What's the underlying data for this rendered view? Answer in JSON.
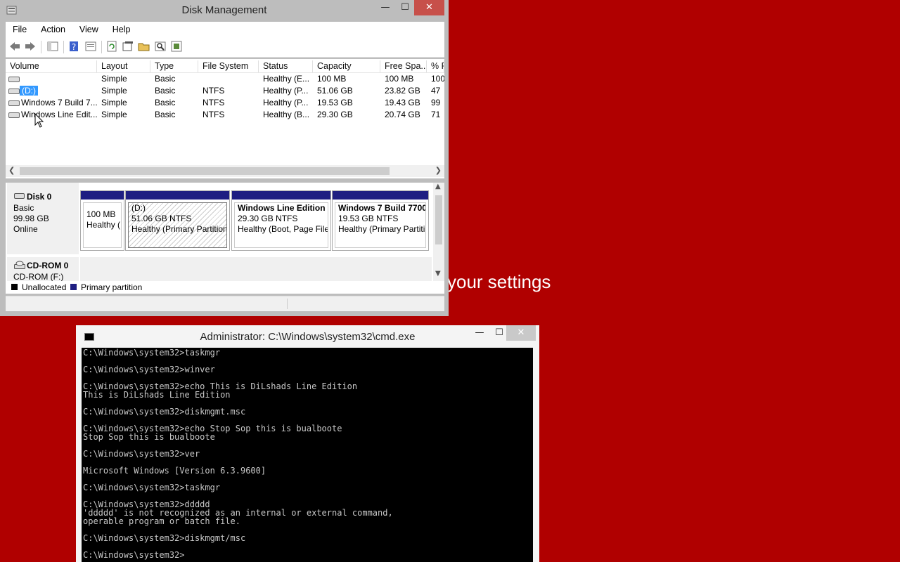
{
  "background": {
    "color": "#b00000",
    "text": "your settings"
  },
  "disk_management": {
    "title": "Disk Management",
    "window_buttons": {
      "minimize": "—",
      "maximize": "☐",
      "close": "✕"
    },
    "menu": [
      "File",
      "Action",
      "View",
      "Help"
    ],
    "toolbar_icons": [
      "back-icon",
      "forward-icon",
      "console-tree-icon",
      "help-icon",
      "properties-icon",
      "refresh-icon",
      "rescan-icon",
      "open-icon",
      "explore-icon",
      "settings-icon"
    ],
    "columns": [
      "Volume",
      "Layout",
      "Type",
      "File System",
      "Status",
      "Capacity",
      "Free Spa...",
      "% F"
    ],
    "rows": [
      {
        "volume": "",
        "layout": "Simple",
        "type": "Basic",
        "fs": "",
        "status": "Healthy (E...",
        "capacity": "100 MB",
        "free": "100 MB",
        "pct": "100"
      },
      {
        "volume": "(D:)",
        "layout": "Simple",
        "type": "Basic",
        "fs": "NTFS",
        "status": "Healthy (P...",
        "capacity": "51.06 GB",
        "free": "23.82 GB",
        "pct": "47"
      },
      {
        "volume": "Windows 7 Build 7...",
        "layout": "Simple",
        "type": "Basic",
        "fs": "NTFS",
        "status": "Healthy (P...",
        "capacity": "19.53 GB",
        "free": "19.43 GB",
        "pct": "99"
      },
      {
        "volume": "Windows Line Edit...",
        "layout": "Simple",
        "type": "Basic",
        "fs": "NTFS",
        "status": "Healthy (B...",
        "capacity": "29.30 GB",
        "free": "20.74 GB",
        "pct": "71"
      }
    ],
    "disk0": {
      "name": "Disk 0",
      "type": "Basic",
      "size": "99.98 GB",
      "state": "Online"
    },
    "partitions": [
      {
        "title": "",
        "line1": "100 MB",
        "line2": "Healthy ("
      },
      {
        "title": "(D:)",
        "line1": "51.06 GB NTFS",
        "line2": "Healthy (Primary Partition"
      },
      {
        "title": "Windows Line Edition  (",
        "line1": "29.30 GB NTFS",
        "line2": "Healthy (Boot, Page File,"
      },
      {
        "title": "Windows 7 Build 7700",
        "line1": "19.53 GB NTFS",
        "line2": "Healthy (Primary Partiti"
      }
    ],
    "cdrom": {
      "name": "CD-ROM 0",
      "drive": "CD-ROM (F:)"
    },
    "legend": [
      {
        "label": "Unallocated",
        "color": "#000000"
      },
      {
        "label": "Primary partition",
        "color": "#1e1e82"
      }
    ]
  },
  "cmd": {
    "title": "Administrator: C:\\Windows\\system32\\cmd.exe",
    "window_buttons": {
      "minimize": "—",
      "maximize": "☐",
      "close": "✕"
    },
    "lines": [
      "C:\\Windows\\system32>taskmgr",
      "",
      "C:\\Windows\\system32>winver",
      "",
      "C:\\Windows\\system32>echo This is DiLshads Line Edition",
      "This is DiLshads Line Edition",
      "",
      "C:\\Windows\\system32>diskmgmt.msc",
      "",
      "C:\\Windows\\system32>echo Stop Sop this is bualboote",
      "Stop Sop this is bualboote",
      "",
      "C:\\Windows\\system32>ver",
      "",
      "Microsoft Windows [Version 6.3.9600]",
      "",
      "C:\\Windows\\system32>taskmgr",
      "",
      "C:\\Windows\\system32>ddddd",
      "'ddddd' is not recognized as an internal or external command,",
      "operable program or batch file.",
      "",
      "C:\\Windows\\system32>diskmgmt/msc",
      "",
      "C:\\Windows\\system32>"
    ]
  }
}
